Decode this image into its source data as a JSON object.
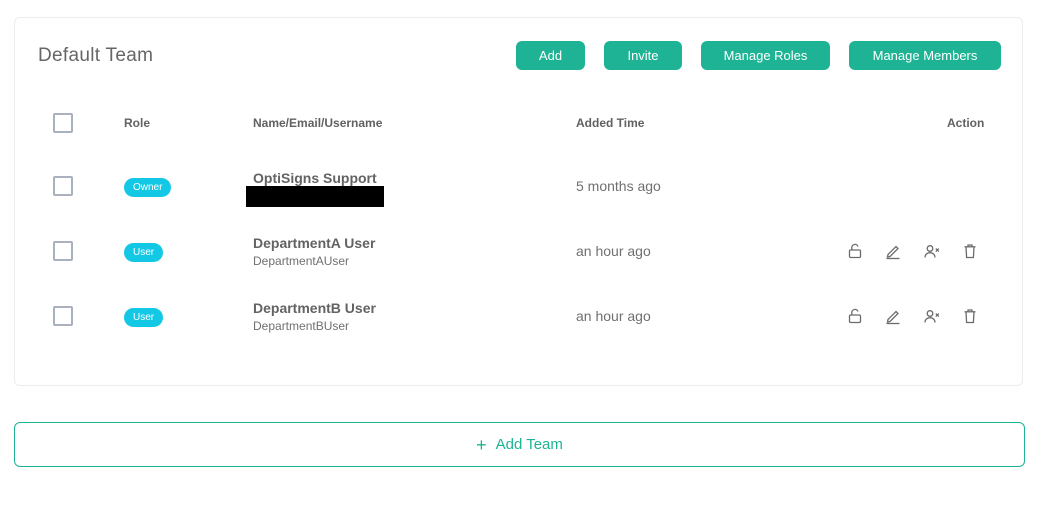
{
  "team": {
    "title": "Default Team",
    "buttons": {
      "add": "Add",
      "invite": "Invite",
      "manage_roles": "Manage Roles",
      "manage_members": "Manage Members"
    },
    "columns": {
      "role": "Role",
      "name": "Name/Email/Username",
      "added_time": "Added Time",
      "action": "Action"
    },
    "rows": [
      {
        "role": "Owner",
        "name": "OptiSigns Support",
        "username": "",
        "added": "5 months ago",
        "actions": []
      },
      {
        "role": "User",
        "name": "DepartmentA User",
        "username": "DepartmentAUser",
        "added": "an hour ago",
        "actions": [
          "unlock-icon",
          "edit-icon",
          "remove-user-icon",
          "trash-icon"
        ]
      },
      {
        "role": "User",
        "name": "DepartmentB User",
        "username": "DepartmentBUser",
        "added": "an hour ago",
        "actions": [
          "unlock-icon",
          "edit-icon",
          "remove-user-icon",
          "trash-icon"
        ]
      }
    ]
  },
  "add_team": {
    "icon": "plus-icon",
    "label": "Add Team"
  },
  "colors": {
    "accent": "#1db394",
    "badge": "#13c8e4"
  }
}
